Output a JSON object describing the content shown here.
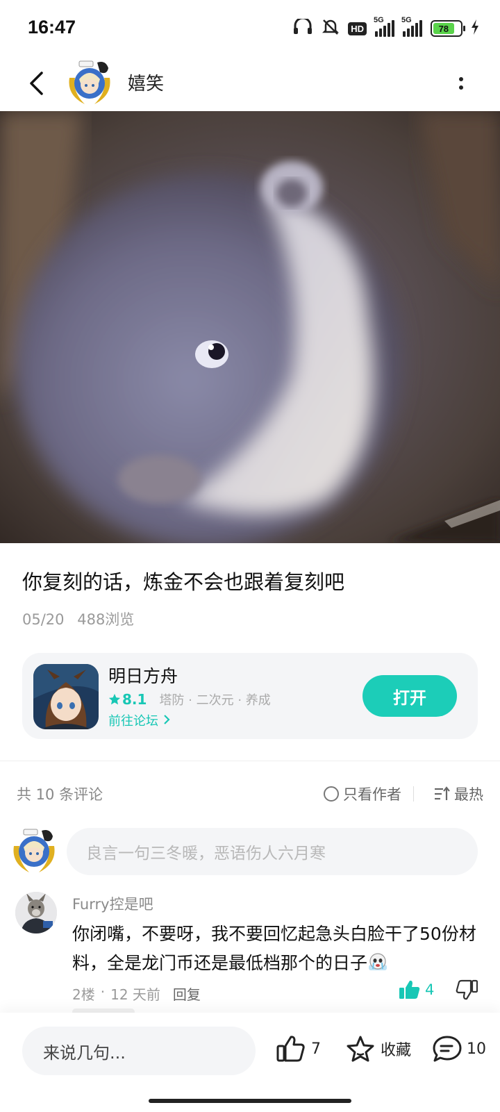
{
  "status_bar": {
    "time": "16:47",
    "hd_label": "HD",
    "signal1_label": "5G",
    "signal2_label": "5G",
    "battery_level": "78",
    "icons": [
      "headphones-icon",
      "mute-bell-icon",
      "hd-icon",
      "signal-icon",
      "signal-icon",
      "battery-icon",
      "charging-icon"
    ]
  },
  "header": {
    "title": "嬉笑",
    "back_icon": "back-arrow-icon",
    "more_icon": "more-vertical-icon"
  },
  "post": {
    "title": "你复刻的话，炼金不会也跟着复刻吧",
    "date": "05/20",
    "views": "488浏览"
  },
  "game_card": {
    "name": "明日方舟",
    "rating": "8.1",
    "tags": "塔防 · 二次元 · 养成",
    "forum_link": "前往论坛",
    "open_button": "打开"
  },
  "comments_bar": {
    "count_text": "共 10 条评论",
    "author_only": "只看作者",
    "sort_label": "最热"
  },
  "comment_input": {
    "placeholder": "良言一句三冬暖，恶语伤人六月寒"
  },
  "comments": [
    {
      "user": "Furry控是吧",
      "text": "你闭嘴，不要呀，我不要回忆起急头白脸干了50份材料，全是龙门币还是最低档那个的日子",
      "floor": "2楼",
      "time": "12 天前",
      "reply": "回复",
      "likes": "4"
    }
  ],
  "bottom_bar": {
    "input_placeholder": "来说几句...",
    "like_count": "7",
    "favorite_label": "收藏",
    "comment_count": "10"
  },
  "colors": {
    "accent": "#1ccdb8",
    "rating": "#18c7b5",
    "battery": "#5ad34b"
  }
}
